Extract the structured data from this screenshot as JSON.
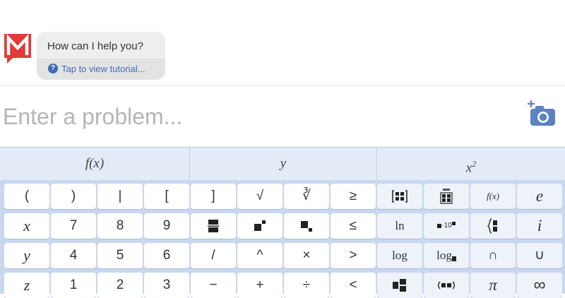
{
  "chat": {
    "message": "How can I help you?",
    "tutorial_link": "Tap to view tutorial...",
    "help_icon_glyph": "?"
  },
  "input": {
    "placeholder": "Enter a problem..."
  },
  "keyboard": {
    "tabs": [
      {
        "label": "f(x)"
      },
      {
        "label": "y"
      },
      {
        "label": "x",
        "sup": "2"
      }
    ],
    "keys": {
      "open_paren": "(",
      "close_paren": ")",
      "abs": "|",
      "open_bracket": "[",
      "close_bracket": "]",
      "sqrt": "√",
      "nthroot": "∛",
      "geq": "≥",
      "fx": "f(x)",
      "e": "e",
      "x": "x",
      "seven": "7",
      "eight": "8",
      "nine": "9",
      "leq": "≤",
      "ln": "ln",
      "times10": "·10",
      "i": "i",
      "y": "y",
      "four": "4",
      "five": "5",
      "six": "6",
      "divide_slash": "/",
      "caret": "^",
      "times": "×",
      "gt": ">",
      "log": "log",
      "logb": "log",
      "cap": "∩",
      "cup": "∪",
      "z": "z",
      "one": "1",
      "two": "2",
      "three": "3",
      "minus": "−",
      "plus": "+",
      "div": "÷",
      "lt": "<",
      "pi": "π",
      "infinity": "∞"
    },
    "colors": {
      "keyboard_bg": "#c9d7ef",
      "tab_bg": "#e3ebf7",
      "key_bg": "#ffffff",
      "key_alt_bg": "#eef2f9",
      "accent": "#3d6bb3",
      "logo_red": "#e03a3a"
    }
  }
}
